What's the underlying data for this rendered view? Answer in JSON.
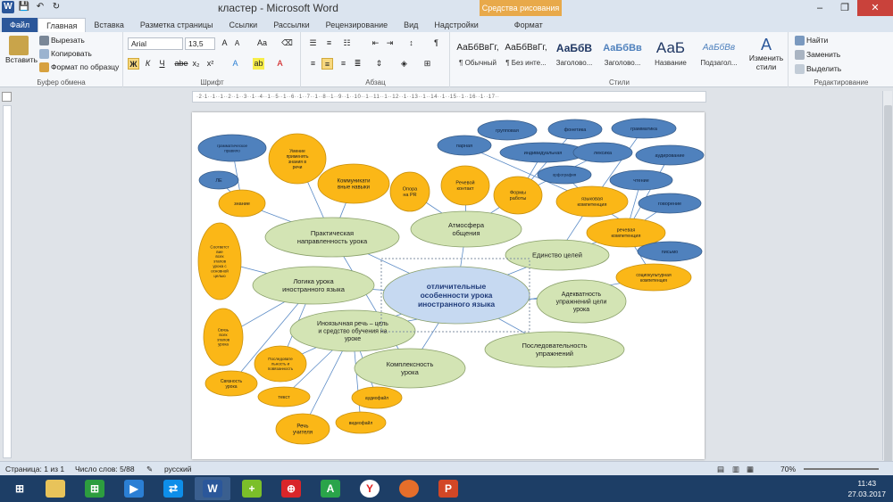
{
  "window": {
    "title": "кластер - Microsoft Word",
    "context_tab": "Средства рисования",
    "minimize": "–",
    "maximize": "❐",
    "close": "✕"
  },
  "tabs": [
    "Файл",
    "Главная",
    "Вставка",
    "Разметка страницы",
    "Ссылки",
    "Рассылки",
    "Рецензирование",
    "Вид",
    "Надстройки",
    "Формат"
  ],
  "ribbon": {
    "clipboard": {
      "label": "Буфер обмена",
      "paste": "Вставить",
      "cut": "Вырезать",
      "copy": "Копировать",
      "format_painter": "Формат по образцу"
    },
    "font": {
      "label": "Шрифт",
      "name": "Arial",
      "size": "13,5",
      "bold": "Ж",
      "italic": "К",
      "underline": "Ч",
      "strike": "abe",
      "sub": "x₂",
      "sup": "x²"
    },
    "paragraph": {
      "label": "Абзац"
    },
    "styles": {
      "label": "Стили",
      "items": [
        {
          "sample": "АаБбВвГг,",
          "name": "¶ Обычный"
        },
        {
          "sample": "АаБбВвГг,",
          "name": "¶ Без инте..."
        },
        {
          "sample": "АаБбВ",
          "name": "Заголово..."
        },
        {
          "sample": "АаБбВв",
          "name": "Заголово..."
        },
        {
          "sample": "АаБ",
          "name": "Название"
        },
        {
          "sample": "АаБбВв",
          "name": "Подзагол..."
        }
      ],
      "change": "Изменить стили"
    },
    "editing": {
      "label": "Редактирование",
      "find": "Найти",
      "replace": "Заменить",
      "select": "Выделить"
    }
  },
  "ruler_text": "·2·1··1··1··2··1··3··1··4··1··5··1··6··1··7··1··8··1··9··1··10··1··11··1··12··1··13··1··14··1··15··1··16··1··17··",
  "diagram": {
    "center": "отличительные особенности урока иностранного языка",
    "main_nodes": [
      "Практическая направленность урока",
      "Атмосфера общения",
      "Единство целей",
      "Логика урока иностранного языка",
      "Адекватность упражнений цели урока",
      "Иноязычная речь – цель и средство обучения на уроке",
      "Последовательность упражнений",
      "Комплексность урока"
    ],
    "yellow_nodes": [
      "Умение применять знания в речи",
      "Коммуникативные навыки",
      "Речевой контакт",
      "Опора на РR",
      "Формы работы",
      "языковая компетенция",
      "речевая компетенция",
      "социокультурная компетенция",
      "знание",
      "Соответствие всех этапов урока с основной целью",
      "Связь всех этапов урока",
      "Связность урока",
      "Последовательность и повязанность",
      "текст",
      "Речь учителя",
      "видеофайл",
      "аудиофайл"
    ],
    "blue_nodes": [
      "грамматическое правило",
      "ЛЕ",
      "групповая",
      "фонетика",
      "грамматика",
      "парная",
      "индивидуальная",
      "лексика",
      "аудирование",
      "орфография",
      "чтение",
      "говорение",
      "письмо"
    ]
  },
  "status": {
    "page": "Страница: 1 из 1",
    "words": "Число слов: 5/88",
    "lang": "русский",
    "zoom": "70%"
  },
  "taskbar": {
    "time": "11:43",
    "date": "27.03.2017"
  }
}
